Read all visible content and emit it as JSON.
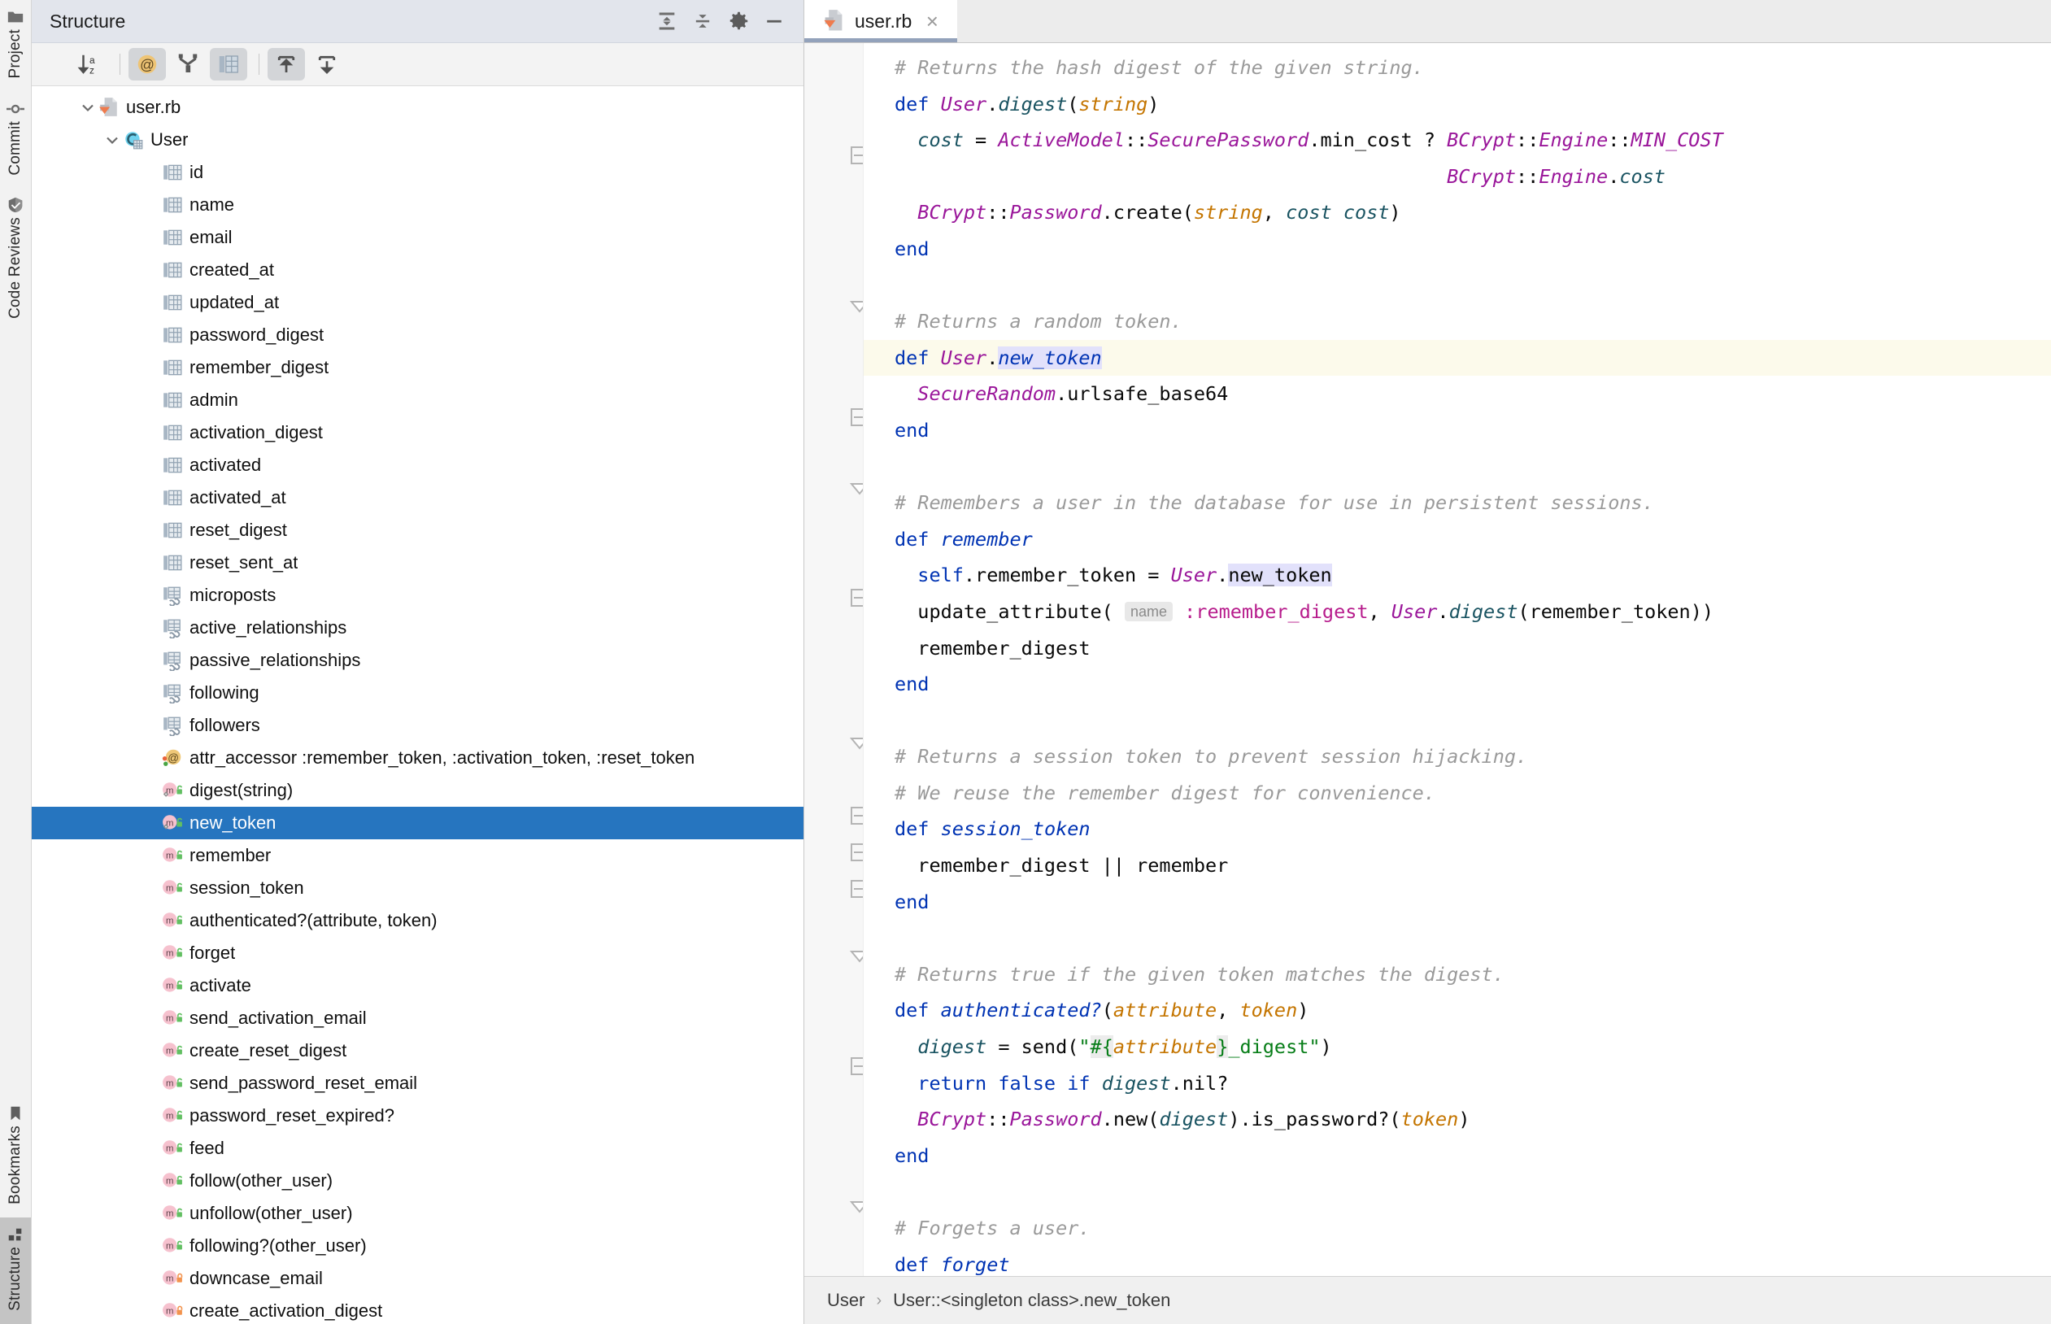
{
  "rail": {
    "top_items": [
      {
        "label": "Project",
        "icon": "folder-icon",
        "active": false
      },
      {
        "label": "Commit",
        "icon": "commit-icon",
        "active": false
      },
      {
        "label": "Code Reviews",
        "icon": "code-review-icon",
        "active": false
      }
    ],
    "bottom_items": [
      {
        "label": "Bookmarks",
        "icon": "bookmark-icon",
        "active": false
      },
      {
        "label": "Structure",
        "icon": "structure-icon",
        "active": true
      }
    ]
  },
  "structure": {
    "title": "Structure",
    "header_buttons": [
      {
        "name": "expand-all-button",
        "icon": "expand-all-icon"
      },
      {
        "name": "collapse-all-button",
        "icon": "collapse-all-icon"
      },
      {
        "name": "settings-button",
        "icon": "gear-icon"
      },
      {
        "name": "hide-button",
        "icon": "minimize-icon"
      }
    ],
    "toolbar": [
      {
        "name": "sort-alphabetically-button",
        "icon": "sort-az-icon",
        "active": false
      },
      {
        "name": "show-properties-button",
        "icon": "at-sign-icon",
        "active": true
      },
      {
        "name": "show-inherited-button",
        "icon": "inheritance-icon",
        "active": false
      },
      {
        "name": "show-fields-button",
        "icon": "fields-table-icon",
        "active": true
      },
      {
        "name": "expand-all-button",
        "icon": "expand-up-icon",
        "active": true
      },
      {
        "name": "collapse-all-button",
        "icon": "collapse-down-icon",
        "active": false
      }
    ],
    "tree": [
      {
        "label": "user.rb",
        "icon": "ruby-file-icon",
        "depth": 0,
        "chevron": "down",
        "selected": false
      },
      {
        "label": "User",
        "icon": "ruby-class-icon",
        "depth": 1,
        "chevron": "down",
        "selected": false
      },
      {
        "label": "id",
        "icon": "db-column-icon",
        "depth": 2,
        "chevron": "none",
        "selected": false
      },
      {
        "label": "name",
        "icon": "db-column-icon",
        "depth": 2,
        "chevron": "none",
        "selected": false
      },
      {
        "label": "email",
        "icon": "db-column-icon",
        "depth": 2,
        "chevron": "none",
        "selected": false
      },
      {
        "label": "created_at",
        "icon": "db-column-icon",
        "depth": 2,
        "chevron": "none",
        "selected": false
      },
      {
        "label": "updated_at",
        "icon": "db-column-icon",
        "depth": 2,
        "chevron": "none",
        "selected": false
      },
      {
        "label": "password_digest",
        "icon": "db-column-icon",
        "depth": 2,
        "chevron": "none",
        "selected": false
      },
      {
        "label": "remember_digest",
        "icon": "db-column-icon",
        "depth": 2,
        "chevron": "none",
        "selected": false
      },
      {
        "label": "admin",
        "icon": "db-column-icon",
        "depth": 2,
        "chevron": "none",
        "selected": false
      },
      {
        "label": "activation_digest",
        "icon": "db-column-icon",
        "depth": 2,
        "chevron": "none",
        "selected": false
      },
      {
        "label": "activated",
        "icon": "db-column-icon",
        "depth": 2,
        "chevron": "none",
        "selected": false
      },
      {
        "label": "activated_at",
        "icon": "db-column-icon",
        "depth": 2,
        "chevron": "none",
        "selected": false
      },
      {
        "label": "reset_digest",
        "icon": "db-column-icon",
        "depth": 2,
        "chevron": "none",
        "selected": false
      },
      {
        "label": "reset_sent_at",
        "icon": "db-column-icon",
        "depth": 2,
        "chevron": "none",
        "selected": false
      },
      {
        "label": "microposts",
        "icon": "db-association-icon",
        "depth": 2,
        "chevron": "none",
        "selected": false
      },
      {
        "label": "active_relationships",
        "icon": "db-association-icon",
        "depth": 2,
        "chevron": "none",
        "selected": false
      },
      {
        "label": "passive_relationships",
        "icon": "db-association-icon",
        "depth": 2,
        "chevron": "none",
        "selected": false
      },
      {
        "label": "following",
        "icon": "db-association-icon",
        "depth": 2,
        "chevron": "none",
        "selected": false
      },
      {
        "label": "followers",
        "icon": "db-association-icon",
        "depth": 2,
        "chevron": "none",
        "selected": false
      },
      {
        "label": "attr_accessor :remember_token, :activation_token, :reset_token",
        "icon": "attr-accessor-icon",
        "depth": 2,
        "chevron": "none",
        "selected": false
      },
      {
        "label": "digest(string)",
        "icon": "method-public-static-icon",
        "depth": 2,
        "chevron": "none",
        "selected": false
      },
      {
        "label": "new_token",
        "icon": "method-public-static-icon",
        "depth": 2,
        "chevron": "none",
        "selected": true
      },
      {
        "label": "remember",
        "icon": "method-public-icon",
        "depth": 2,
        "chevron": "none",
        "selected": false
      },
      {
        "label": "session_token",
        "icon": "method-public-icon",
        "depth": 2,
        "chevron": "none",
        "selected": false
      },
      {
        "label": "authenticated?(attribute, token)",
        "icon": "method-public-icon",
        "depth": 2,
        "chevron": "none",
        "selected": false
      },
      {
        "label": "forget",
        "icon": "method-public-icon",
        "depth": 2,
        "chevron": "none",
        "selected": false
      },
      {
        "label": "activate",
        "icon": "method-public-icon",
        "depth": 2,
        "chevron": "none",
        "selected": false
      },
      {
        "label": "send_activation_email",
        "icon": "method-public-icon",
        "depth": 2,
        "chevron": "none",
        "selected": false
      },
      {
        "label": "create_reset_digest",
        "icon": "method-public-icon",
        "depth": 2,
        "chevron": "none",
        "selected": false
      },
      {
        "label": "send_password_reset_email",
        "icon": "method-public-icon",
        "depth": 2,
        "chevron": "none",
        "selected": false
      },
      {
        "label": "password_reset_expired?",
        "icon": "method-public-icon",
        "depth": 2,
        "chevron": "none",
        "selected": false
      },
      {
        "label": "feed",
        "icon": "method-public-icon",
        "depth": 2,
        "chevron": "none",
        "selected": false
      },
      {
        "label": "follow(other_user)",
        "icon": "method-public-icon",
        "depth": 2,
        "chevron": "none",
        "selected": false
      },
      {
        "label": "unfollow(other_user)",
        "icon": "method-public-icon",
        "depth": 2,
        "chevron": "none",
        "selected": false
      },
      {
        "label": "following?(other_user)",
        "icon": "method-public-icon",
        "depth": 2,
        "chevron": "none",
        "selected": false
      },
      {
        "label": "downcase_email",
        "icon": "method-private-icon",
        "depth": 2,
        "chevron": "none",
        "selected": false
      },
      {
        "label": "create_activation_digest",
        "icon": "method-private-icon",
        "depth": 2,
        "chevron": "none",
        "selected": false
      }
    ]
  },
  "editor": {
    "tab": {
      "label": "user.rb",
      "icon": "ruby-file-icon",
      "close": "×"
    },
    "breadcrumb": {
      "parts": [
        "User",
        "User::<singleton class>.new_token"
      ],
      "separator": "›"
    },
    "code_text": "# Returns the hash digest of the given string.\ndef User.digest(string)\n  cost = ActiveModel::SecurePassword.min_cost ? BCrypt::Engine::MIN_COST :\n                                                BCrypt::Engine.cost\n  BCrypt::Password.create(string, cost: cost)\nend\n\n# Returns a random token.\ndef User.new_token\n  SecureRandom.urlsafe_base64\nend\n\n# Remembers a user in the database for use in persistent sessions.\ndef remember\n  self.remember_token = User.new_token\n  update_attribute( name :remember_digest, User.digest(remember_token))\n  remember_digest\nend\n\n# Returns a session token to prevent session hijacking.\n# We reuse the remember digest for convenience.\ndef session_token\n  remember_digest || remember\nend\n\n# Returns true if the given token matches the digest.\ndef authenticated?(attribute, token)\n  digest = send(\"#{attribute}_digest\")\n  return false if digest.nil?\n  BCrypt::Password.new(digest).is_password?(token)\nend\n\n# Forgets a user.\ndef forget"
  }
}
